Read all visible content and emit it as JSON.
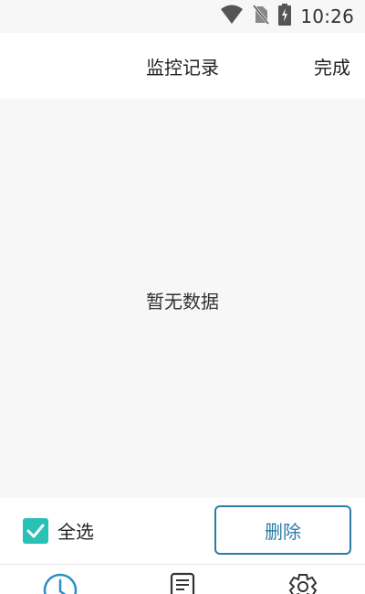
{
  "status_bar": {
    "time": "10:26",
    "icons": [
      "wifi-icon",
      "no-sim-icon",
      "battery-charging-icon"
    ]
  },
  "header": {
    "title": "监控记录",
    "done_label": "完成"
  },
  "main": {
    "empty_text": "暂无数据"
  },
  "action_bar": {
    "select_all_label": "全选",
    "select_all_checked": true,
    "delete_label": "删除"
  },
  "tab_bar": {
    "tabs": [
      {
        "icon": "clock-icon",
        "active": true
      },
      {
        "icon": "document-icon",
        "active": false
      },
      {
        "icon": "gear-icon",
        "active": false
      }
    ]
  },
  "colors": {
    "accent": "#27c1b6",
    "delete_border": "#2a7ca7",
    "active_tab": "#2a8fc4",
    "inactive_tab": "#333333"
  }
}
